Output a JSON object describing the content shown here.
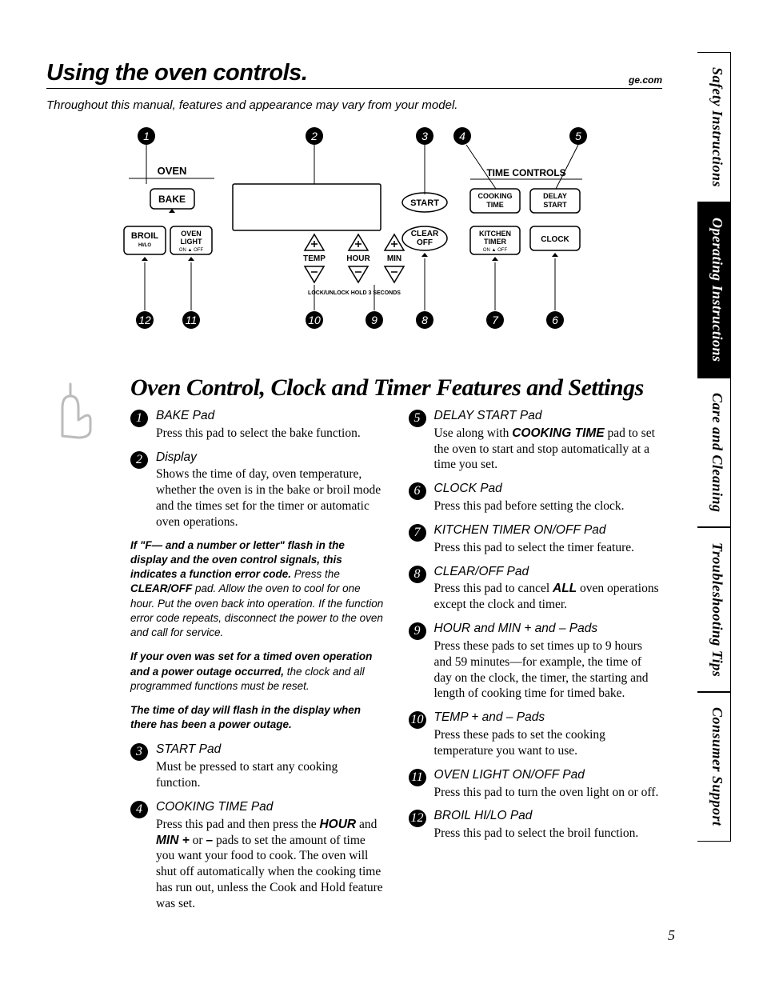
{
  "header": {
    "title": "Using the oven controls.",
    "brand": "ge.com",
    "intro": "Throughout this manual, features and appearance may vary from your model."
  },
  "section_title": "Oven Control, Clock and Timer Features and Settings",
  "diagram": {
    "top_nums": [
      "1",
      "2",
      "3",
      "4",
      "5"
    ],
    "bottom_nums": [
      "12",
      "11",
      "10",
      "9",
      "8",
      "7",
      "6"
    ],
    "labels": {
      "oven": "OVEN",
      "bake": "BAKE",
      "broil": "BROIL",
      "broil_sub": "HI/LO",
      "oven_light": "OVEN LIGHT",
      "oven_light_sub": "ON ▲ OFF",
      "temp": "TEMP",
      "hour": "HOUR",
      "min": "MIN",
      "lock": "LOCK/UNLOCK HOLD 3 SECONDS",
      "start": "START",
      "clear": "CLEAR OFF",
      "time_controls": "TIME CONTROLS",
      "cooking_time": "COOKING TIME",
      "delay_start": "DELAY START",
      "kitchen_timer": "KITCHEN TIMER",
      "kitchen_sub": "ON ▲ OFF",
      "clock": "CLOCK"
    }
  },
  "left": [
    {
      "n": "1",
      "title": "BAKE Pad",
      "body": "Press this pad to select the bake function."
    },
    {
      "n": "2",
      "title": "Display",
      "body": "Shows the time of day, oven temperature, whether the oven is in the bake or broil mode and the times set for the timer or automatic oven operations."
    }
  ],
  "notes": [
    {
      "bold": "If \"F— and a number or letter\" flash in the display and the oven control signals, this indicates a function error code.",
      "rest": " Press the ",
      "kw": "CLEAR/OFF",
      "rest2": " pad. Allow the oven to cool for one hour. Put the oven back into operation. If the function error code repeats, disconnect the power to the oven and call for service."
    },
    {
      "bold": "If your oven was set for a timed oven operation and a power outage occurred,",
      "rest": " the clock and all programmed functions must be reset.",
      "kw": "",
      "rest2": ""
    },
    {
      "bold": "The time of day will flash in the display when there has been a power outage.",
      "rest": "",
      "kw": "",
      "rest2": ""
    }
  ],
  "left2": [
    {
      "n": "3",
      "title": "START Pad",
      "body": "Must be pressed to start any cooking function."
    },
    {
      "n": "4",
      "title": "COOKING TIME Pad",
      "body_pre": "Press this pad and then press the ",
      "kw1": "HOUR",
      "mid": " and ",
      "kw2": "MIN +",
      "mid2": " or ",
      "kw3": "–",
      "body_post": " pads to set the amount of time you want your food to cook. The oven will shut off automatically when the cooking time has run out, unless the Cook and Hold feature was set."
    }
  ],
  "right": [
    {
      "n": "5",
      "title": "DELAY START Pad",
      "body_pre": "Use along with ",
      "kw": "COOKING TIME",
      "body_post": " pad to set the oven to start and stop automatically at a time you set."
    },
    {
      "n": "6",
      "title": "CLOCK Pad",
      "body": "Press this pad before setting the clock."
    },
    {
      "n": "7",
      "title": "KITCHEN TIMER ON/OFF Pad",
      "body": "Press this pad to select the timer feature."
    },
    {
      "n": "8",
      "title": "CLEAR/OFF Pad",
      "body_pre": "Press this pad to cancel ",
      "kw": "ALL",
      "body_post": " oven operations except the clock and timer."
    },
    {
      "n": "9",
      "title": "HOUR and MIN + and – Pads",
      "body": "Press these pads to set times up to 9 hours and 59 minutes—for example, the time of day on the clock, the timer, the starting and length of cooking time for timed bake."
    },
    {
      "n": "10",
      "title": "TEMP + and – Pads",
      "body": "Press these pads to set the cooking temperature you want to use."
    },
    {
      "n": "11",
      "title": "OVEN LIGHT ON/OFF Pad",
      "body": "Press this pad to turn the oven light on or off."
    },
    {
      "n": "12",
      "title": "BROIL HI/LO Pad",
      "body": "Press this pad to select the broil function."
    }
  ],
  "tabs": [
    {
      "label": "Safety Instructions",
      "active": false
    },
    {
      "label": "Operating Instructions",
      "active": true
    },
    {
      "label": "Care and Cleaning",
      "active": false
    },
    {
      "label": "Troubleshooting Tips",
      "active": false
    },
    {
      "label": "Consumer Support",
      "active": false
    }
  ],
  "page_number": "5"
}
